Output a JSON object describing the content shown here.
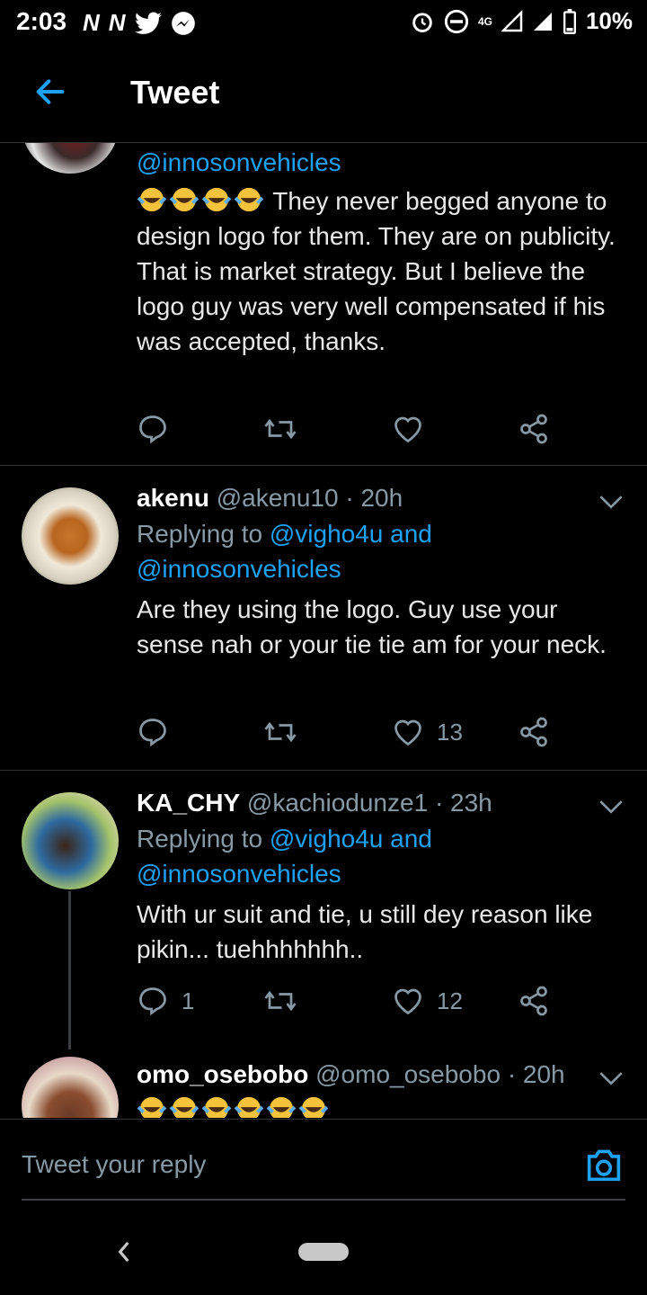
{
  "status_bar": {
    "time": "2:03",
    "left_icons": [
      "N",
      "N",
      "twitter-bird-icon",
      "messenger-icon"
    ],
    "battery": "10%",
    "network": "4G"
  },
  "app_bar": {
    "title": "Tweet"
  },
  "tweets": [
    {
      "mention_line": "@innosonvehicles",
      "text": "They never begged anyone to design logo for them. They are on publicity. That is market strategy. But I believe the logo guy was very well compensated if his was accepted, thanks.",
      "emoji_count": 4,
      "likes": "",
      "replies": ""
    },
    {
      "name": "akenu",
      "handle": "@akenu10",
      "time": "· 20h",
      "replying_label": "Replying to ",
      "replying_to": "@vigho4u and",
      "replying_to_2": "@innosonvehicles",
      "text": "Are they using the logo. Guy use your sense nah or your tie tie am for your neck.",
      "likes": "13",
      "replies": ""
    },
    {
      "name": "KA_CHY",
      "handle": "@kachiodunze1",
      "time": "· 23h",
      "replying_label": "Replying to ",
      "replying_to": "@vigho4u and",
      "replying_to_2": "@innosonvehicles",
      "text": "With ur suit and tie, u still dey reason like pikin... tuehhhhhhh..",
      "likes": "12",
      "replies": "1"
    },
    {
      "name": "omo_osebobo",
      "handle": "@omo_osebobo",
      "time": "· 20h",
      "emoji_count": 6
    }
  ],
  "composer": {
    "placeholder": "Tweet your reply"
  },
  "colors": {
    "accent": "#1da1f2",
    "background": "#000000",
    "muted": "#8899a6",
    "divider": "#2f3336"
  }
}
